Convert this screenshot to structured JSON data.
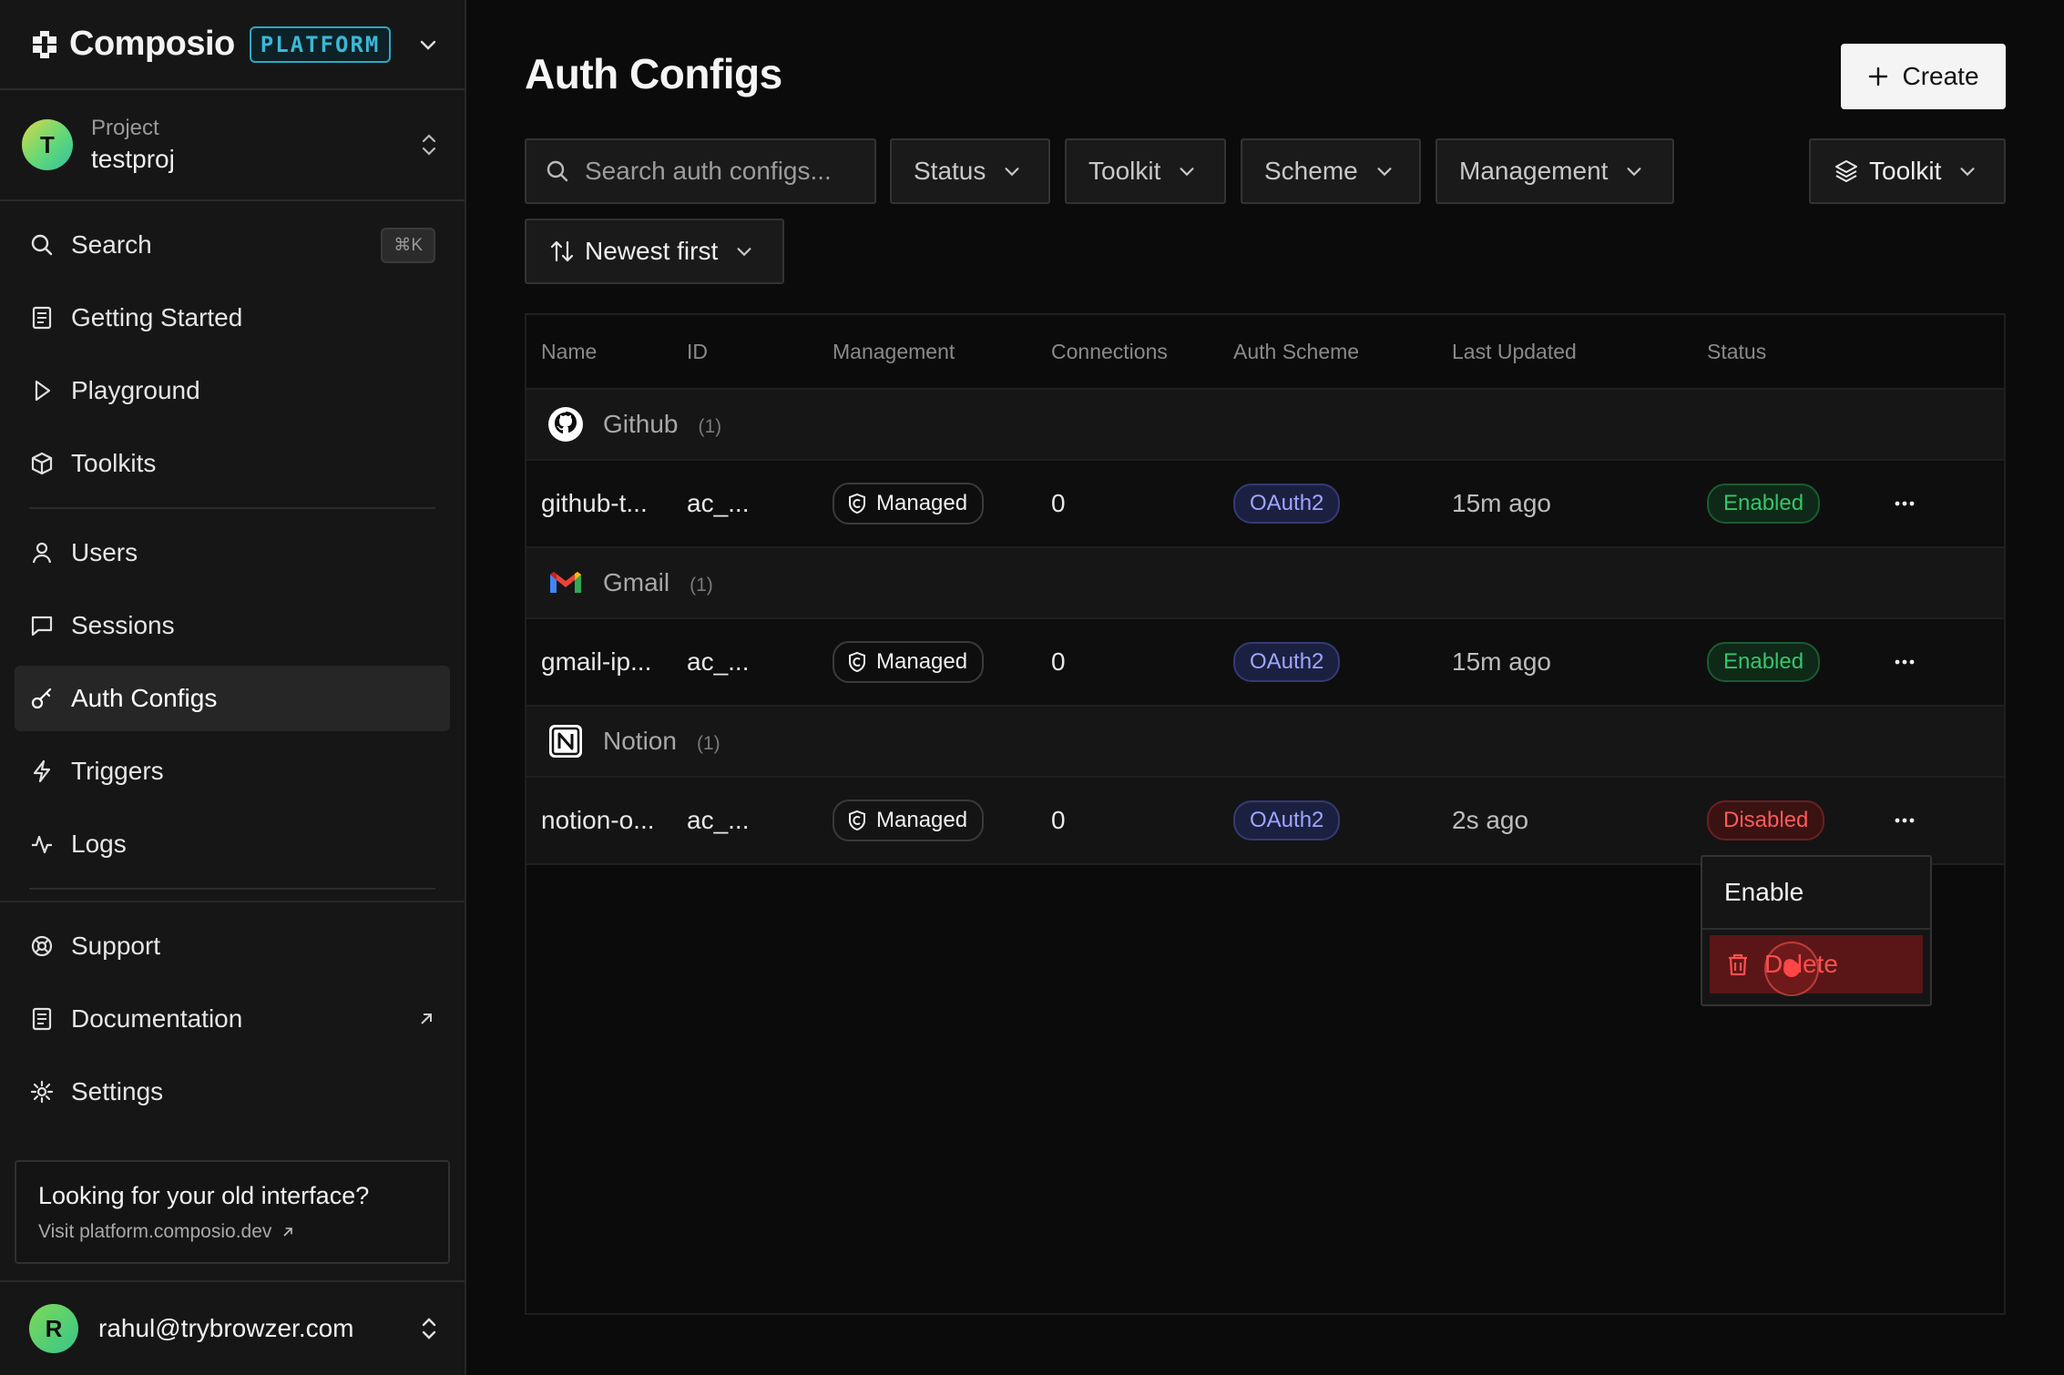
{
  "brand": {
    "name": "Composio",
    "badge": "PLATFORM"
  },
  "project": {
    "avatar_letter": "T",
    "label": "Project",
    "name": "testproj"
  },
  "nav": {
    "search": "Search",
    "search_shortcut": "⌘K",
    "getting_started": "Getting Started",
    "playground": "Playground",
    "toolkits": "Toolkits",
    "users": "Users",
    "sessions": "Sessions",
    "auth_configs": "Auth Configs",
    "triggers": "Triggers",
    "logs": "Logs",
    "support": "Support",
    "documentation": "Documentation",
    "settings": "Settings"
  },
  "old_interface": {
    "title": "Looking for your old interface?",
    "link": "Visit platform.composio.dev"
  },
  "user": {
    "avatar_letter": "R",
    "email": "rahul@trybrowzer.com"
  },
  "page": {
    "title": "Auth Configs",
    "create_label": "Create"
  },
  "filters": {
    "search_placeholder": "Search auth configs...",
    "status": "Status",
    "toolkit": "Toolkit",
    "scheme": "Scheme",
    "management": "Management",
    "group_by": "Toolkit",
    "sort": "Newest first"
  },
  "table": {
    "columns": [
      "Name",
      "ID",
      "Management",
      "Connections",
      "Auth Scheme",
      "Last Updated",
      "Status"
    ],
    "groups": [
      {
        "name": "Github",
        "count": "(1)",
        "logo": "github-logo",
        "row": {
          "name": "github-t...",
          "id": "ac_...",
          "management": "Managed",
          "connections": "0",
          "scheme": "OAuth2",
          "updated": "15m ago",
          "status": "Enabled"
        }
      },
      {
        "name": "Gmail",
        "count": "(1)",
        "logo": "gmail-logo",
        "row": {
          "name": "gmail-ip...",
          "id": "ac_...",
          "management": "Managed",
          "connections": "0",
          "scheme": "OAuth2",
          "updated": "15m ago",
          "status": "Enabled"
        }
      },
      {
        "name": "Notion",
        "count": "(1)",
        "logo": "notion-logo",
        "row": {
          "name": "notion-o...",
          "id": "ac_...",
          "management": "Managed",
          "connections": "0",
          "scheme": "OAuth2",
          "updated": "2s ago",
          "status": "Disabled"
        }
      }
    ]
  },
  "row_menu": {
    "enable": "Enable",
    "delete": "Delete"
  },
  "colors": {
    "background": "#0b0b0b",
    "sidebar": "#161616",
    "accent_platform": "#3bb8d6",
    "enabled": "#35c66a",
    "disabled": "#ff5a5a",
    "oauth": "#9ea6ff"
  }
}
